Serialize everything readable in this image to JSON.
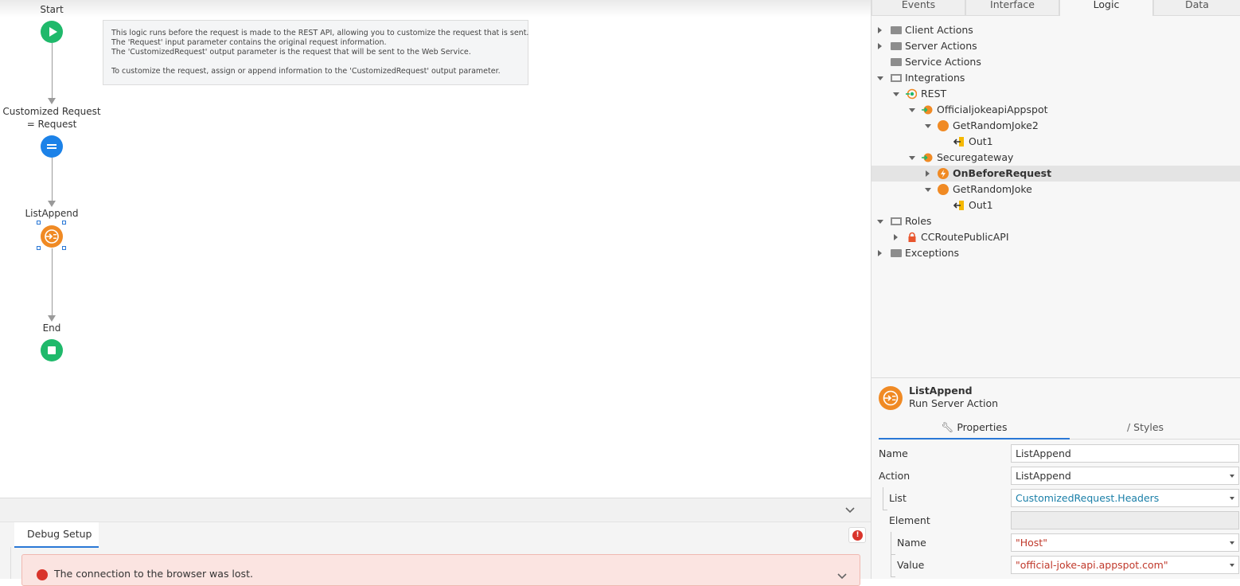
{
  "flow": {
    "start_label": "Start",
    "assign_label": "Customized Request = Request",
    "action_label": "ListAppend",
    "end_label": "End",
    "comment_lines": [
      "This logic runs before the request is made to the REST API, allowing you to customize the request that is sent.",
      "The 'Request' input parameter contains the original request information.",
      "The 'CustomizedRequest' output parameter is the request that will be sent to the Web Service.",
      "",
      "To customize the request, assign or append information to the 'CustomizedRequest' output parameter."
    ]
  },
  "bottom": {
    "tab_label": "Debug Setup",
    "error_message": "The connection to the browser was lost."
  },
  "tabs": [
    "Events",
    "Interface",
    "Logic",
    "Data"
  ],
  "active_tab": "Logic",
  "tree": {
    "client_actions": "Client Actions",
    "server_actions": "Server Actions",
    "service_actions": "Service Actions",
    "integrations": "Integrations",
    "rest": "REST",
    "api1": "OfficialjokeapiAppspot",
    "api1_method": "GetRandomJoke2",
    "api1_out": "Out1",
    "api2": "Securegateway",
    "on_before_request": "OnBeforeRequest",
    "api2_method": "GetRandomJoke",
    "api2_out": "Out1",
    "roles": "Roles",
    "role1": "CCRoutePublicAPI",
    "exceptions": "Exceptions"
  },
  "properties": {
    "title": "ListAppend",
    "subtitle": "Run Server Action",
    "tab_properties": "Properties",
    "tab_styles": "Styles",
    "rows": {
      "name_label": "Name",
      "name_value": "ListAppend",
      "action_label": "Action",
      "action_value": "ListAppend",
      "list_label": "List",
      "list_value": "CustomizedRequest.Headers",
      "element_label": "Element",
      "element_value": "",
      "el_name_label": "Name",
      "el_name_value": "\"Host\"",
      "el_value_label": "Value",
      "el_value_value": "\"official-joke-api.appspot.com\""
    }
  },
  "colors": {
    "accent": "#2a78d6",
    "start_node": "#1fb96b",
    "assign_node": "#1c82e8",
    "action_node": "#f08a24",
    "end_node": "#1fb96b",
    "expression": "#1a7fa8",
    "string": "#c0392b"
  }
}
